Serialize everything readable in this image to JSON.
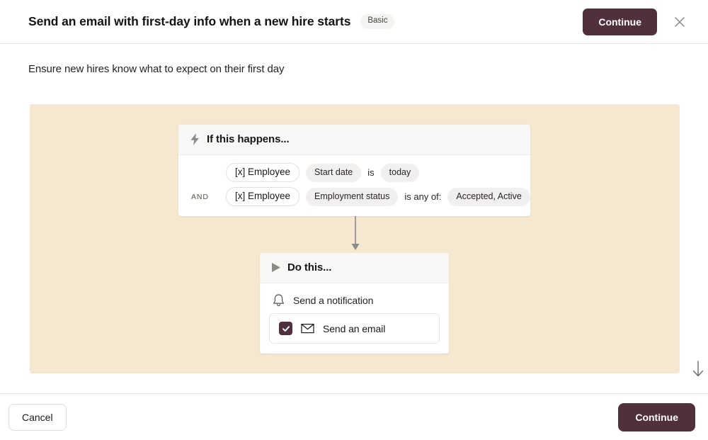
{
  "header": {
    "title": "Send an email with first-day info when a new hire starts",
    "badge": "Basic",
    "continue_label": "Continue",
    "close_icon": "close-icon"
  },
  "subtitle": "Ensure new hires know what to expect on their first day",
  "trigger": {
    "heading": "If this happens...",
    "icon": "lightning-bolt-icon",
    "conditions": [
      {
        "connector": "",
        "object": "[x] Employee",
        "field": "Start date",
        "operator": "is",
        "value": "today"
      },
      {
        "connector": "AND",
        "object": "[x] Employee",
        "field": "Employment status",
        "operator": "is any of:",
        "value": "Accepted, Active"
      }
    ]
  },
  "action": {
    "heading": "Do this...",
    "icon": "play-triangle-icon",
    "notification_label": "Send a notification",
    "notification_icon": "bell-icon",
    "email_label": "Send an email",
    "email_icon": "envelope-icon",
    "email_checked": true
  },
  "footer": {
    "cancel_label": "Cancel",
    "continue_label": "Continue"
  },
  "scroll_hint_icon": "arrow-down-icon",
  "colors": {
    "accent": "#50303c",
    "canvas": "#f6e8d0",
    "chip_solid": "#f1f0ef",
    "border": "#e7e5e4"
  }
}
